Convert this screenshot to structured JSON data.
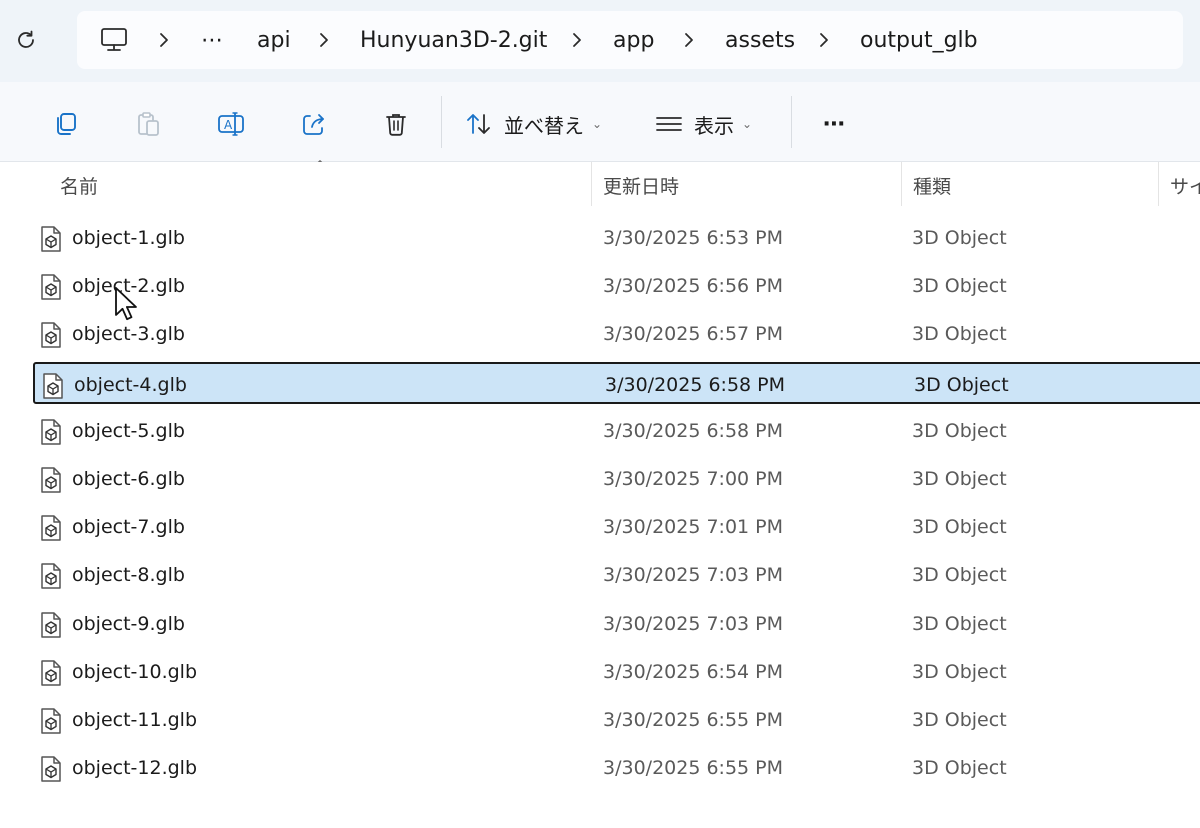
{
  "breadcrumb": {
    "items": [
      "api",
      "Hunyuan3D-2.git",
      "app",
      "assets",
      "output_glb"
    ],
    "overflow": "⋯"
  },
  "toolbar": {
    "sort_label": "並べ替え",
    "view_label": "表示",
    "more_label": "⋯"
  },
  "columns": {
    "name": "名前",
    "modified": "更新日時",
    "type": "種類",
    "size": "サイ"
  },
  "files": [
    {
      "name": "object-1.glb",
      "modified": "3/30/2025 6:53 PM",
      "type": "3D Object"
    },
    {
      "name": "object-2.glb",
      "modified": "3/30/2025 6:56 PM",
      "type": "3D Object"
    },
    {
      "name": "object-3.glb",
      "modified": "3/30/2025 6:57 PM",
      "type": "3D Object"
    },
    {
      "name": "object-4.glb",
      "modified": "3/30/2025 6:58 PM",
      "type": "3D Object"
    },
    {
      "name": "object-5.glb",
      "modified": "3/30/2025 6:58 PM",
      "type": "3D Object"
    },
    {
      "name": "object-6.glb",
      "modified": "3/30/2025 7:00 PM",
      "type": "3D Object"
    },
    {
      "name": "object-7.glb",
      "modified": "3/30/2025 7:01 PM",
      "type": "3D Object"
    },
    {
      "name": "object-8.glb",
      "modified": "3/30/2025 7:03 PM",
      "type": "3D Object"
    },
    {
      "name": "object-9.glb",
      "modified": "3/30/2025 7:03 PM",
      "type": "3D Object"
    },
    {
      "name": "object-10.glb",
      "modified": "3/30/2025 6:54 PM",
      "type": "3D Object"
    },
    {
      "name": "object-11.glb",
      "modified": "3/30/2025 6:55 PM",
      "type": "3D Object"
    },
    {
      "name": "object-12.glb",
      "modified": "3/30/2025 6:55 PM",
      "type": "3D Object"
    }
  ],
  "selected_file": "object-4.glb",
  "colors": {
    "selection": "#cce4f7",
    "address_bg": "#eff4f9",
    "toolbar_bg": "#f7f9fc",
    "accent": "#1a73c8"
  }
}
